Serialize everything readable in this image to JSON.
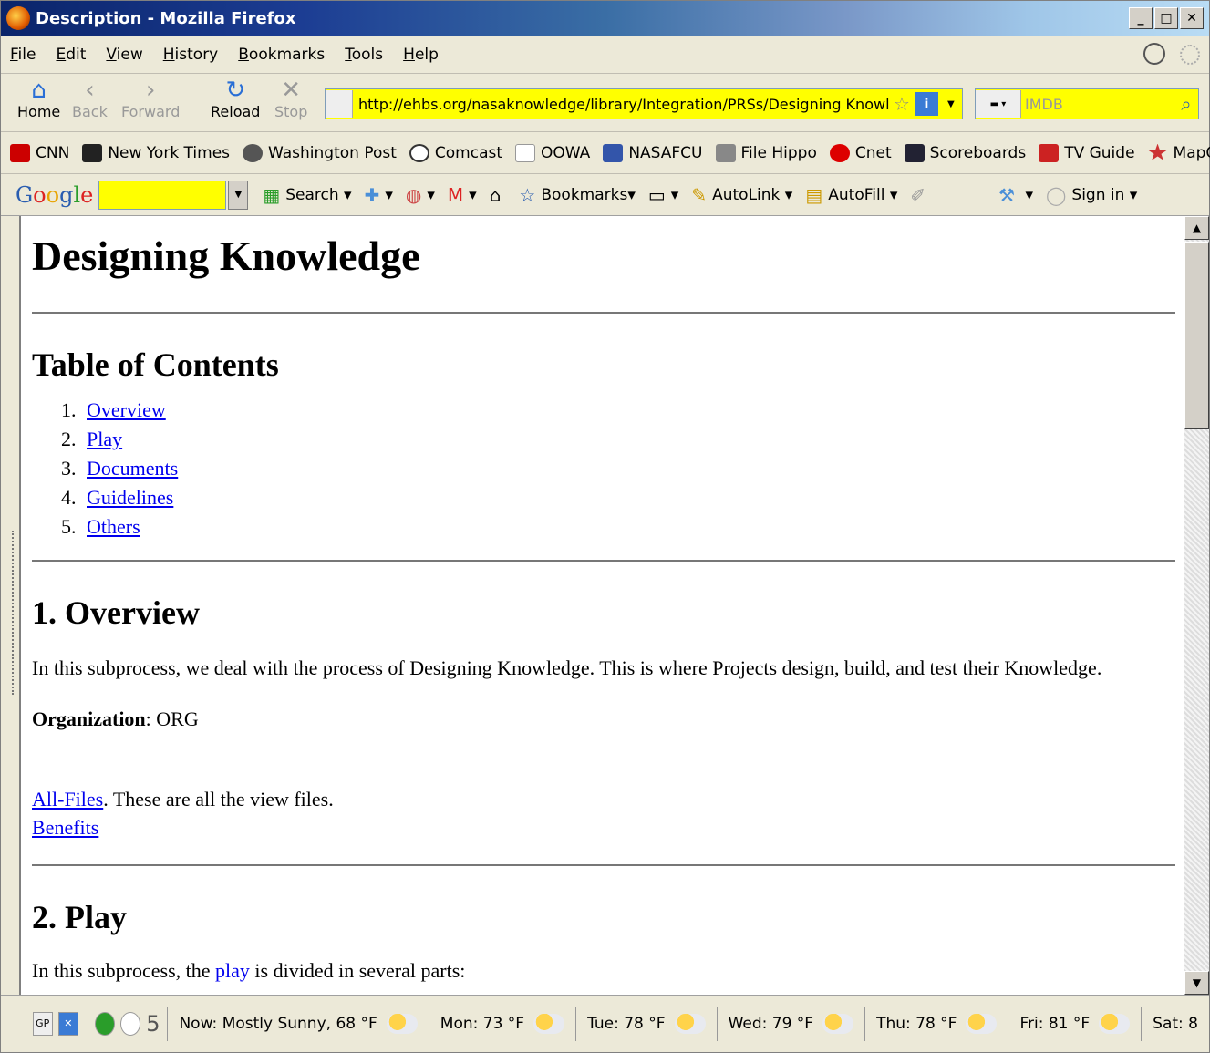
{
  "window": {
    "title": "Description - Mozilla Firefox"
  },
  "menu": [
    "File",
    "Edit",
    "View",
    "History",
    "Bookmarks",
    "Tools",
    "Help"
  ],
  "nav": {
    "home": "Home",
    "back": "Back",
    "forward": "Forward",
    "reload": "Reload",
    "stop": "Stop",
    "url": "http://ehbs.org/nasaknowledge/library/Integration/PRSs/Designing Knowledg",
    "search_placeholder": "IMDB"
  },
  "bookmarks": [
    "CNN",
    "New York Times",
    "Washington Post",
    "Comcast",
    "OOWA",
    "NASAFCU",
    "File Hippo",
    "Cnet",
    "Scoreboards",
    "TV Guide",
    "MapQuest"
  ],
  "google_toolbar": {
    "logo": "Google",
    "search": "Search",
    "bookmarks": "Bookmarks",
    "autolink": "AutoLink",
    "autofill": "AutoFill",
    "signin": "Sign in"
  },
  "page": {
    "title": "Designing Knowledge",
    "toc_heading": "Table of Contents",
    "toc": [
      {
        "n": "1.",
        "label": "Overview"
      },
      {
        "n": "2.",
        "label": "Play"
      },
      {
        "n": "3.",
        "label": "Documents"
      },
      {
        "n": "4.",
        "label": "Guidelines"
      },
      {
        "n": "5.",
        "label": "Others"
      }
    ],
    "overview_heading": "1. Overview",
    "overview_text": "In this subprocess, we deal with the process of Designing Knowledge. This is where Projects design, build, and test their Knowledge.",
    "org_label": "Organization",
    "org_value": ": ORG",
    "allfiles_link": "All-Files",
    "allfiles_text": ". These are all the view files.",
    "benefits_link": "Benefits",
    "play_heading": "2. Play",
    "play_text_1": "In this subprocess, the ",
    "play_link": "play",
    "play_text_2": " is divided in several parts:"
  },
  "status": {
    "gp": "GP",
    "count": "5",
    "weather": [
      "Now: Mostly Sunny, 68 °F",
      "Mon: 73 °F",
      "Tue: 78 °F",
      "Wed: 79 °F",
      "Thu: 78 °F",
      "Fri: 81 °F",
      "Sat: 8"
    ]
  }
}
